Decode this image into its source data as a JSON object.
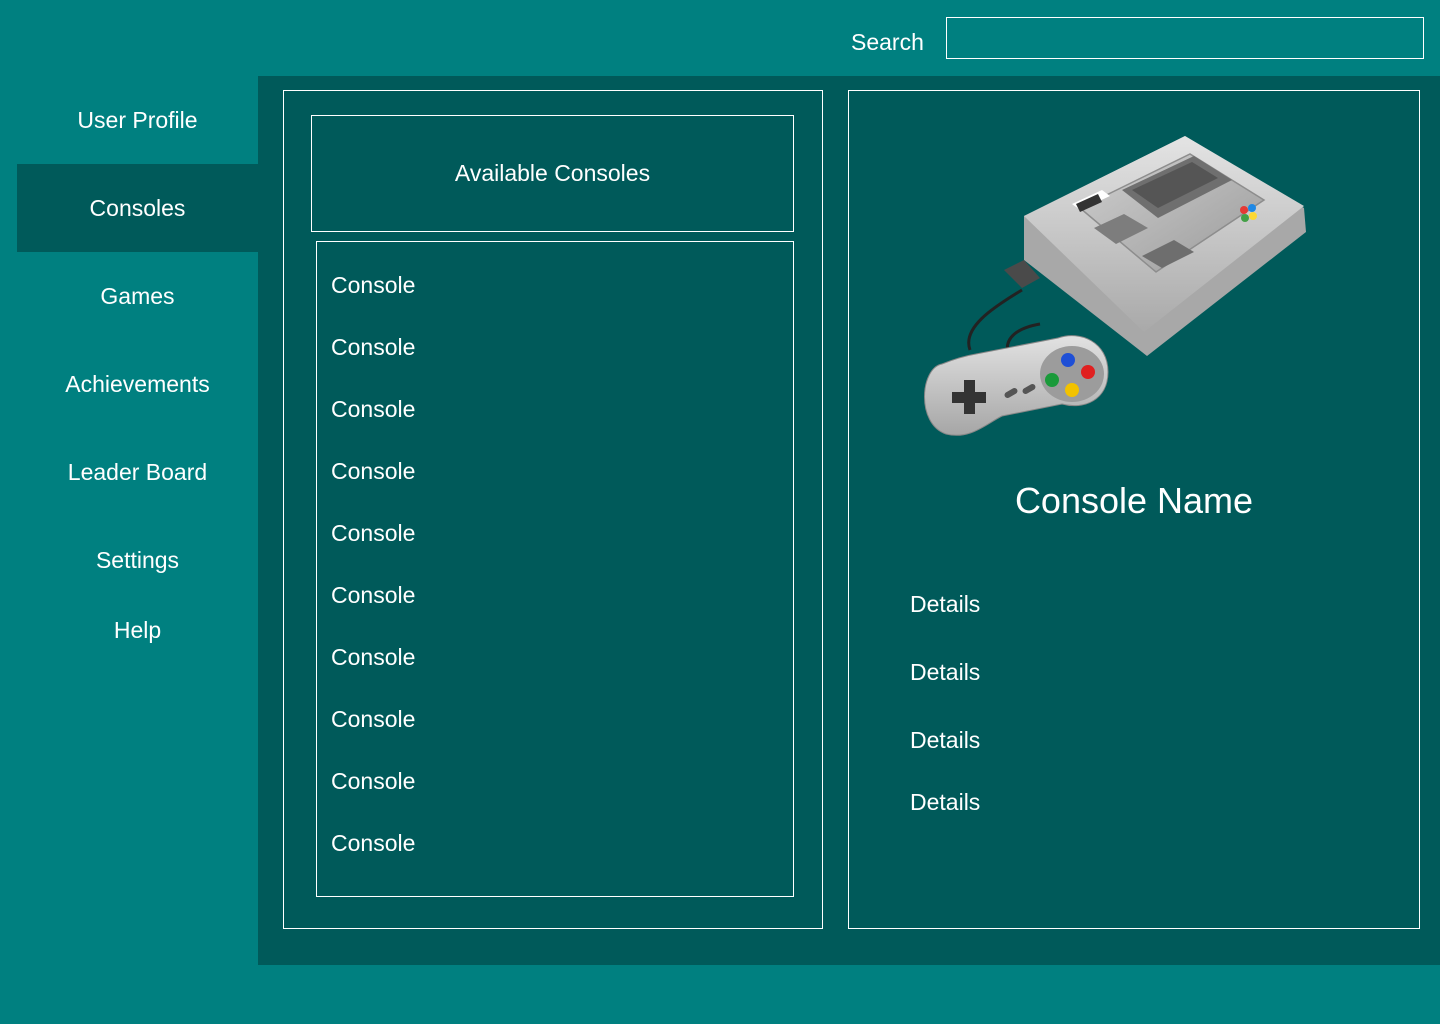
{
  "search": {
    "label": "Search",
    "value": "",
    "placeholder": ""
  },
  "sidebar": {
    "items": [
      {
        "label": "User Profile"
      },
      {
        "label": "Consoles"
      },
      {
        "label": "Games"
      },
      {
        "label": "Achievements"
      },
      {
        "label": "Leader Board"
      },
      {
        "label": "Settings"
      },
      {
        "label": "Help"
      }
    ],
    "active_item": "Consoles"
  },
  "console_list": {
    "header": "Available Consoles",
    "items": [
      {
        "label": "Console"
      },
      {
        "label": "Console"
      },
      {
        "label": "Console"
      },
      {
        "label": "Console"
      },
      {
        "label": "Console"
      },
      {
        "label": "Console"
      },
      {
        "label": "Console"
      },
      {
        "label": "Console"
      },
      {
        "label": "Console"
      },
      {
        "label": "Console"
      }
    ]
  },
  "detail_panel": {
    "image_label": "Nintendo Super Famicom console with controller",
    "console_name": "Console Name",
    "details": [
      {
        "label": "Details"
      },
      {
        "label": "Details"
      },
      {
        "label": "Details"
      },
      {
        "label": "Details"
      }
    ]
  },
  "colors": {
    "background": "#008080",
    "panel": "#005a5a",
    "text": "#ffffff"
  }
}
